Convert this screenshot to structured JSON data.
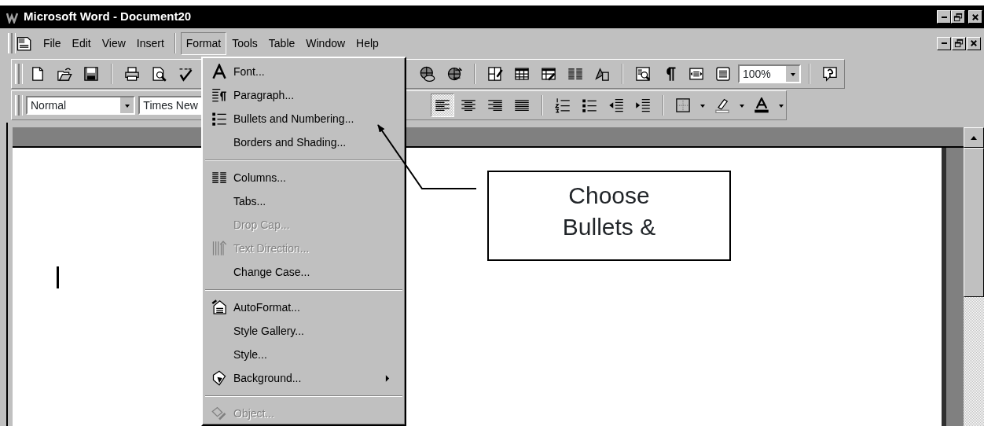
{
  "window": {
    "title": "Microsoft Word - Document20"
  },
  "menu_bar": [
    {
      "label": "File",
      "selected": false
    },
    {
      "label": "Edit",
      "selected": false
    },
    {
      "label": "View",
      "selected": false
    },
    {
      "label": "Insert",
      "selected": false
    },
    {
      "label": "Format",
      "selected": true
    },
    {
      "label": "Tools",
      "selected": false
    },
    {
      "label": "Table",
      "selected": false
    },
    {
      "label": "Window",
      "selected": false
    },
    {
      "label": "Help",
      "selected": false
    }
  ],
  "standard_toolbar": {
    "zoom": "100%"
  },
  "formatting_toolbar": {
    "style": "Normal",
    "font": "Times New",
    "alignment": [
      {
        "selected": true
      },
      {
        "selected": false
      },
      {
        "selected": false
      },
      {
        "selected": false
      }
    ]
  },
  "format_menu": [
    {
      "kind": "item",
      "label": "Font...",
      "disabled": false,
      "submenu": false
    },
    {
      "kind": "item",
      "label": "Paragraph...",
      "disabled": false,
      "submenu": false
    },
    {
      "kind": "item",
      "label": "Bullets and Numbering...",
      "disabled": false,
      "submenu": false
    },
    {
      "kind": "item",
      "label": "Borders and Shading...",
      "disabled": false,
      "submenu": false
    },
    {
      "kind": "separator"
    },
    {
      "kind": "item",
      "label": "Columns...",
      "disabled": false,
      "submenu": false
    },
    {
      "kind": "item",
      "label": "Tabs...",
      "disabled": false,
      "submenu": false
    },
    {
      "kind": "item",
      "label": "Drop Cap...",
      "disabled": true,
      "submenu": false
    },
    {
      "kind": "item",
      "label": "Text Direction...",
      "disabled": true,
      "submenu": false
    },
    {
      "kind": "item",
      "label": "Change Case...",
      "disabled": false,
      "submenu": false
    },
    {
      "kind": "separator"
    },
    {
      "kind": "item",
      "label": "AutoFormat...",
      "disabled": false,
      "submenu": false
    },
    {
      "kind": "item",
      "label": "Style Gallery...",
      "disabled": false,
      "submenu": false
    },
    {
      "kind": "item",
      "label": "Style...",
      "disabled": false,
      "submenu": false
    },
    {
      "kind": "item",
      "label": "Background...",
      "disabled": false,
      "submenu": true
    },
    {
      "kind": "separator"
    },
    {
      "kind": "item",
      "label": "Object...",
      "disabled": true,
      "submenu": false
    }
  ],
  "callout": {
    "lines": [
      "Choose",
      "Bullets &"
    ]
  }
}
